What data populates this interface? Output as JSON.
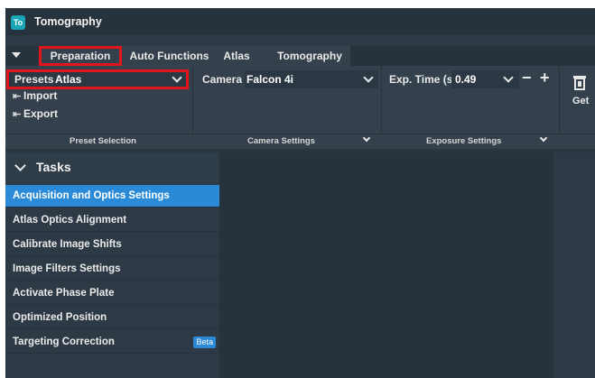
{
  "app": {
    "logo_text": "To",
    "title": "Tomography"
  },
  "tabs": [
    {
      "label": "Preparation",
      "active": true
    },
    {
      "label": "Auto Functions"
    },
    {
      "label": "Atlas"
    },
    {
      "label": "Tomography"
    }
  ],
  "presets": {
    "label": "Presets",
    "value": "Atlas",
    "import_label": "Import",
    "export_label": "Export",
    "group_caption": "Preset Selection"
  },
  "camera": {
    "label": "Camera",
    "value": "Falcon 4i",
    "group_caption": "Camera Settings"
  },
  "exposure": {
    "label": "Exp. Time (s)",
    "value": "0.49",
    "minus": "−",
    "plus": "+",
    "group_caption": "Exposure Settings"
  },
  "get": {
    "label": "Get"
  },
  "tasks": {
    "title": "Tasks",
    "items": [
      {
        "label": "Acquisition and Optics Settings",
        "active": true
      },
      {
        "label": "Atlas Optics Alignment"
      },
      {
        "label": "Calibrate Image Shifts"
      },
      {
        "label": "Image Filters Settings"
      },
      {
        "label": "Activate Phase Plate"
      },
      {
        "label": "Optimized Position"
      },
      {
        "label": "Targeting Correction",
        "badge": "Beta"
      }
    ]
  },
  "colors": {
    "accent": "#2a8ad8",
    "highlight": "#e2141c",
    "panel": "#34414c",
    "background": "#26333d"
  }
}
